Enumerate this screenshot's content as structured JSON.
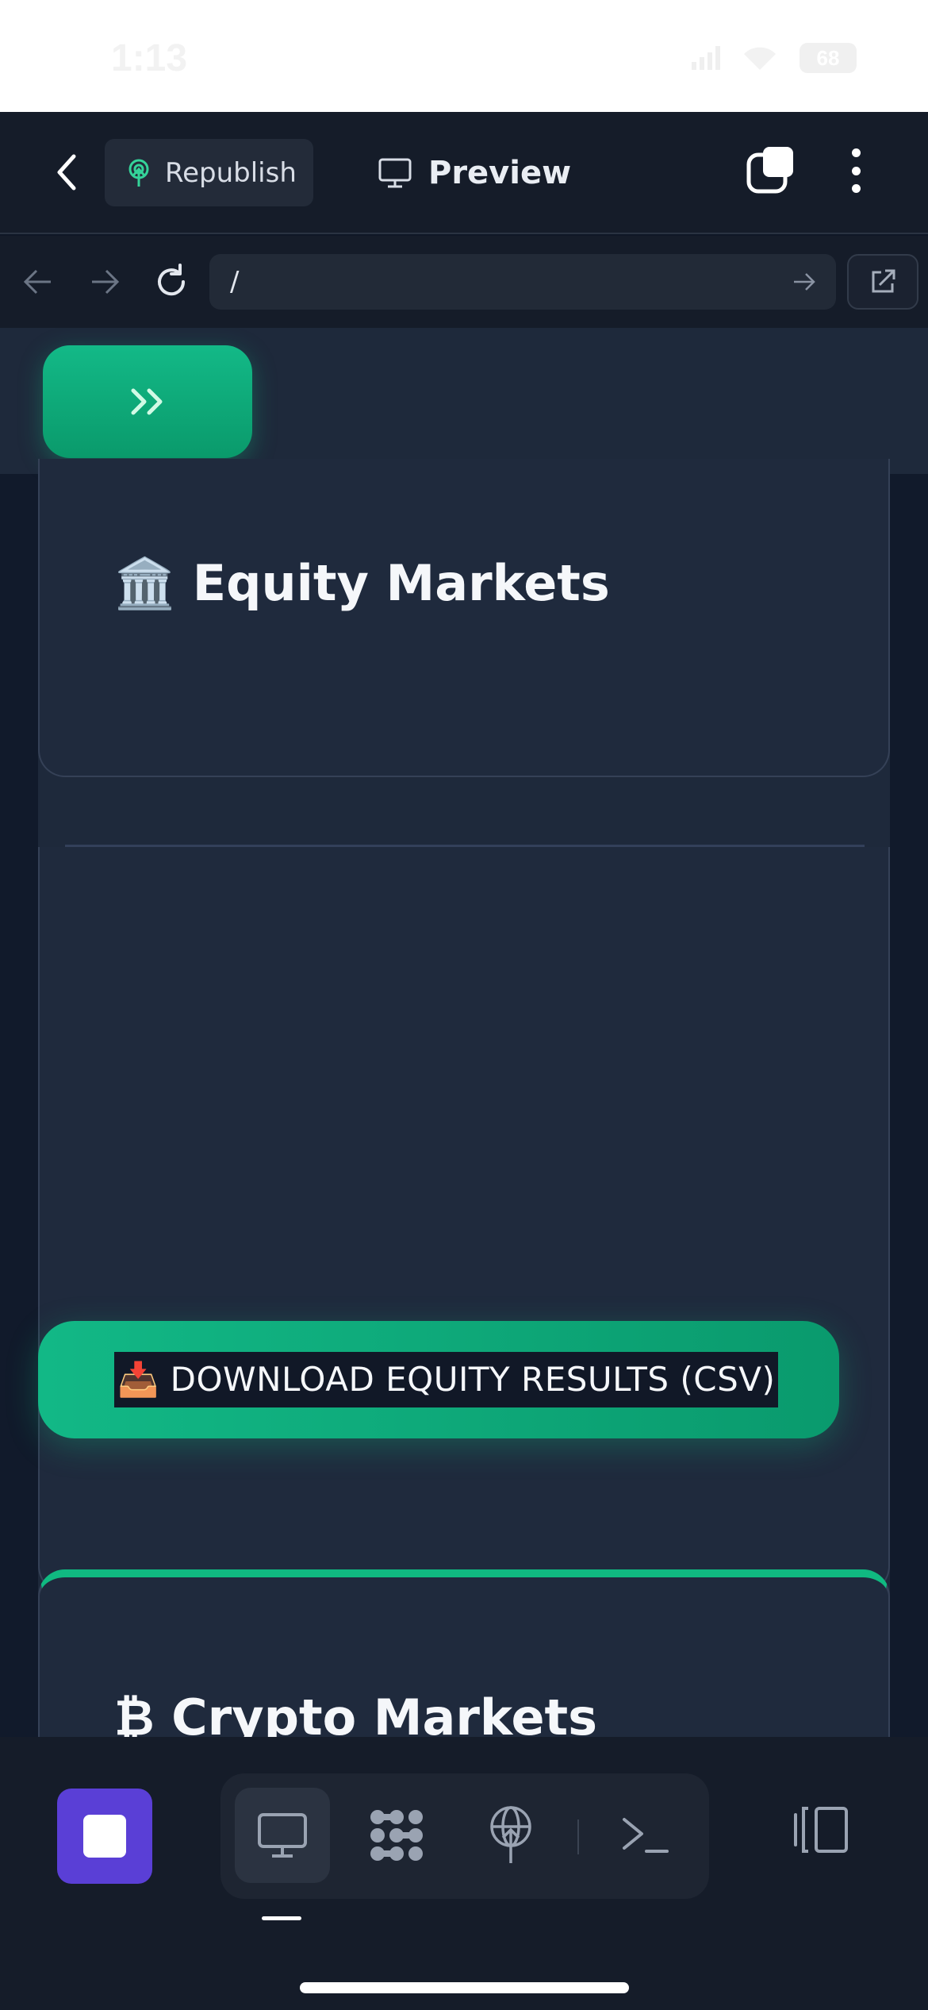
{
  "status_bar": {
    "time": "1:13",
    "battery": "68"
  },
  "header": {
    "republish_label": "Republish",
    "preview_label": "Preview"
  },
  "browser": {
    "url": "/"
  },
  "content": {
    "equity_title": "🏛️ Equity Markets",
    "csv_button_label": "📥 DOWNLOAD EQUITY RESULTS (CSV)",
    "crypto_title": "₿ Crypto Markets"
  },
  "colors": {
    "accent_green": "#10b981",
    "stop_purple": "#5a3fd6",
    "panel_bg": "#1e293b"
  },
  "icons": {
    "header": [
      "back-icon",
      "republish-icon",
      "monitor-icon",
      "tabs-icon",
      "more-icon"
    ],
    "browser": [
      "nav-back-icon",
      "nav-forward-icon",
      "reload-icon",
      "go-icon",
      "external-link-icon"
    ],
    "dock": [
      "stop-icon",
      "desktop-icon",
      "workspace-icon",
      "deploy-icon",
      "terminal-icon",
      "panel-toggle-icon"
    ],
    "viewport": [
      "double-chevron-right-icon"
    ]
  }
}
